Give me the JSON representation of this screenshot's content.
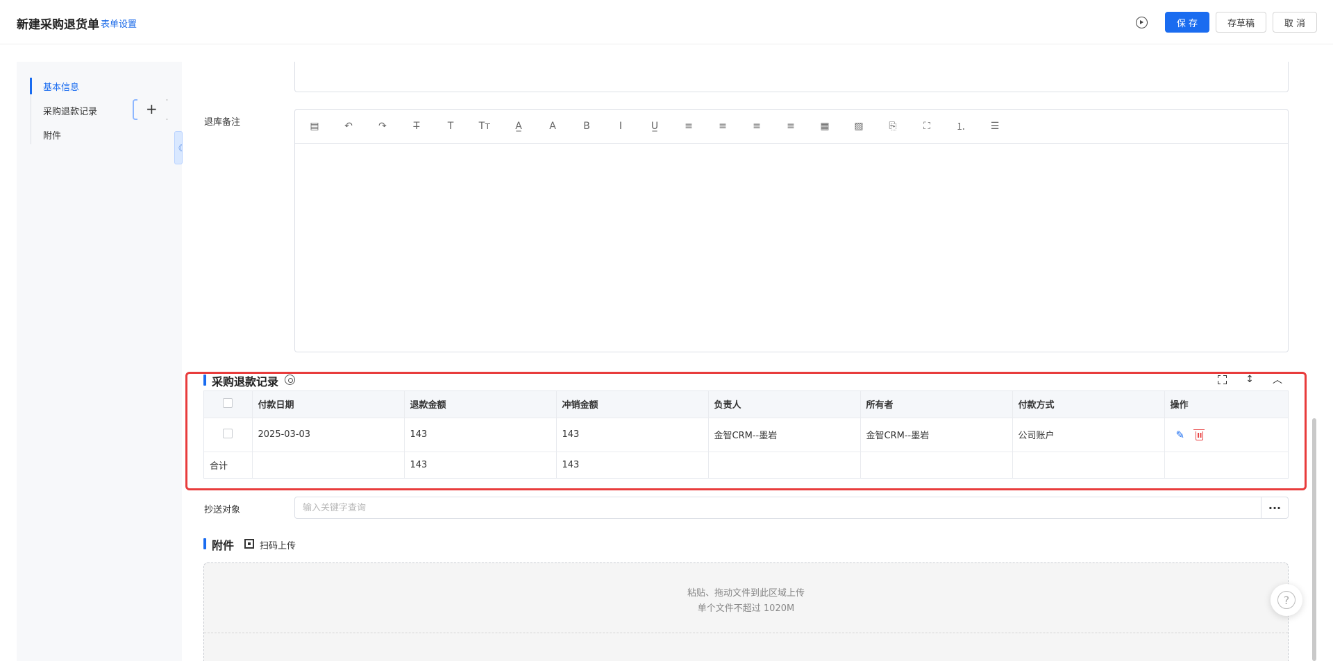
{
  "header": {
    "title": "新建采购退货单",
    "form_settings": "表单设置",
    "save": "保 存",
    "draft": "存草稿",
    "cancel": "取 消",
    "play_icon": "play-circle-icon"
  },
  "nav": {
    "items": [
      {
        "label": "基本信息"
      },
      {
        "label": "采购退款记录"
      },
      {
        "label": "附件"
      }
    ],
    "add": "+",
    "collapse": "《"
  },
  "form": {
    "remark_label": "退库备注",
    "toolbar_icons": [
      "template-icon",
      "undo-icon",
      "redo-icon",
      "strikethrough-icon",
      "text-icon",
      "font-size-icon",
      "font-color-icon",
      "bg-color-icon",
      "bold-icon",
      "italic-icon",
      "underline-icon",
      "align-left-icon",
      "align-center-icon",
      "align-right-icon",
      "justify-icon",
      "table-icon",
      "image-icon",
      "attachment-icon",
      "fullscreen-icon",
      "ordered-list-icon",
      "unordered-list-icon"
    ],
    "toolbar_glyphs": [
      "▤",
      "↶",
      "↷",
      "T̶",
      "T",
      "Tт",
      "A̲",
      "A",
      "B",
      "I",
      "U̲",
      "≡",
      "≡",
      "≡",
      "≡",
      "▦",
      "▨",
      "⎘",
      "⛶",
      "⒈",
      "☰"
    ]
  },
  "refund": {
    "title": "采购退款记录",
    "columns": [
      "付款日期",
      "退款金额",
      "冲销金额",
      "负责人",
      "所有者",
      "付款方式",
      "操作"
    ],
    "rows": [
      {
        "date": "2025-03-03",
        "refund": "143",
        "offset": "143",
        "owner": "金智CRM--墨岩",
        "holder": "金智CRM--墨岩",
        "method": "公司账户"
      }
    ],
    "summary": {
      "label": "合计",
      "refund": "143",
      "offset": "143"
    }
  },
  "cc": {
    "label": "抄送对象",
    "placeholder": "输入关键字查询",
    "more": "···"
  },
  "attachment": {
    "title": "附件",
    "scan": "扫码上传",
    "drop_line1": "粘贴、拖动文件到此区域上传",
    "drop_line2": "单个文件不超过 1020M"
  },
  "help": "?",
  "colors": {
    "accent": "#1a6cf0",
    "highlight": "#e83c3c",
    "danger": "#e84545"
  }
}
